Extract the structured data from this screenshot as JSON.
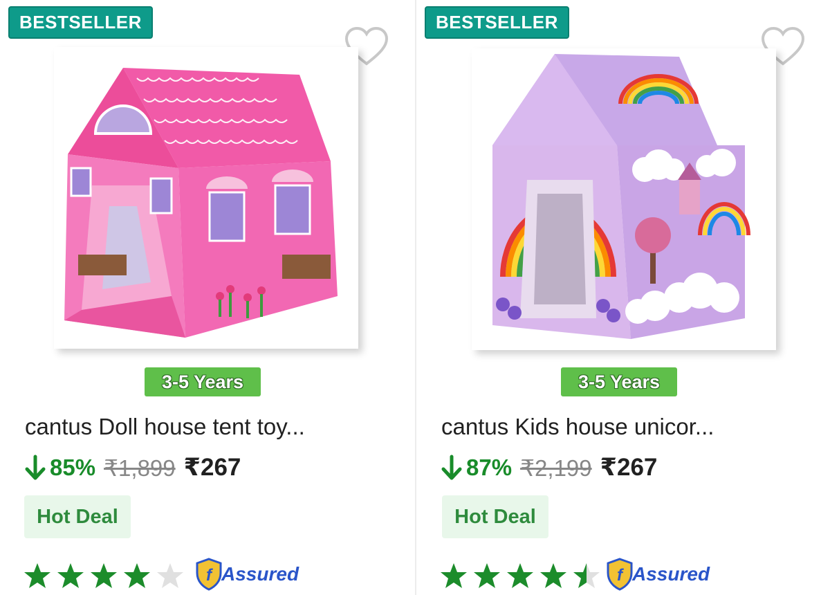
{
  "products": [
    {
      "badge": "BESTSELLER",
      "wishlist_icon": "heart-outline-icon",
      "image_alt": "pink doll house tent",
      "age": "3-5 Years",
      "title": "cantus Doll house tent toy...",
      "discount": "85%",
      "mrp": "₹1,899",
      "price": "₹267",
      "deal": "Hot Deal",
      "rating": 4,
      "assured": "Assured"
    },
    {
      "badge": "BESTSELLER",
      "wishlist_icon": "heart-outline-icon",
      "image_alt": "purple unicorn house tent",
      "age": "3-5 Years",
      "title": "cantus Kids house unicor...",
      "discount": "87%",
      "mrp": "₹2,199",
      "price": "₹267",
      "deal": "Hot Deal",
      "rating": 4.5,
      "assured": "Assured"
    }
  ],
  "colors": {
    "badge": "#0e9b8a",
    "discount": "#198c2a",
    "star_filled": "#1c8c2b",
    "star_empty": "#e0e0e0",
    "assured": "#2a55c9",
    "deal_bg": "#e8f7ea"
  }
}
